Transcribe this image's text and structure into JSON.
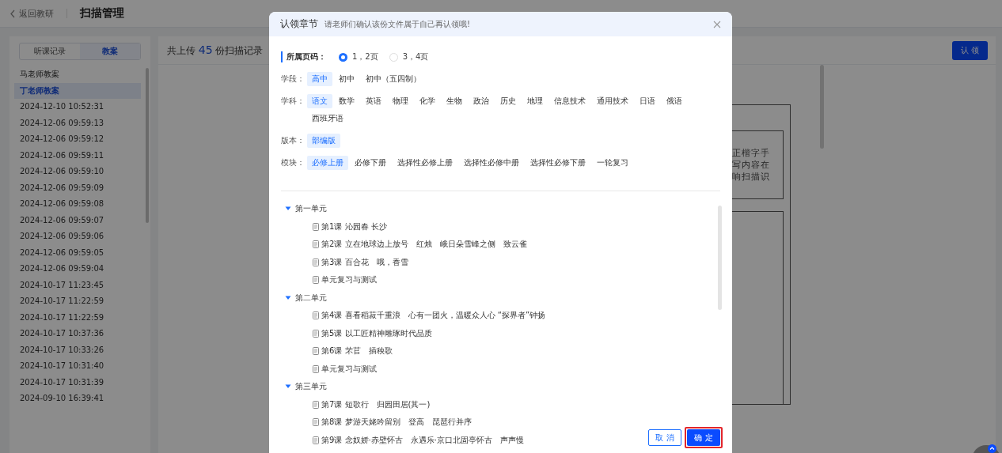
{
  "topbar": {
    "back_link": "返回教研",
    "title": "扫描管理"
  },
  "sidebar": {
    "tabs": [
      {
        "label": "听课记录",
        "selected": false
      },
      {
        "label": "教案",
        "selected": true
      }
    ],
    "items": [
      {
        "label": "马老师教案",
        "selected": false
      },
      {
        "label": "丁老师教案",
        "selected": true
      },
      {
        "label": "2024-12-10 10:52:31",
        "selected": false
      },
      {
        "label": "2024-12-06 09:59:13",
        "selected": false
      },
      {
        "label": "2024-12-06 09:59:12",
        "selected": false
      },
      {
        "label": "2024-12-06 09:59:11",
        "selected": false
      },
      {
        "label": "2024-12-06 09:59:10",
        "selected": false
      },
      {
        "label": "2024-12-06 09:59:09",
        "selected": false
      },
      {
        "label": "2024-12-06 09:59:08",
        "selected": false
      },
      {
        "label": "2024-12-06 09:59:07",
        "selected": false
      },
      {
        "label": "2024-12-06 09:59:06",
        "selected": false
      },
      {
        "label": "2024-12-06 09:59:05",
        "selected": false
      },
      {
        "label": "2024-12-06 09:59:04",
        "selected": false
      },
      {
        "label": "2024-10-17 11:23:45",
        "selected": false
      },
      {
        "label": "2024-10-17 11:22:59",
        "selected": false
      },
      {
        "label": "2024-10-17 11:22:59",
        "selected": false
      },
      {
        "label": "2024-10-17 10:37:36",
        "selected": false
      },
      {
        "label": "2024-10-17 10:33:26",
        "selected": false
      },
      {
        "label": "2024-10-17 10:31:40",
        "selected": false
      },
      {
        "label": "2024-10-17 10:31:39",
        "selected": false
      },
      {
        "label": "2024-09-10 16:39:41",
        "selected": false
      }
    ]
  },
  "main": {
    "summary": {
      "prefix": "共上传",
      "count": "45",
      "suffix": "份扫描记录"
    },
    "claim_button": "认 领",
    "document_lines": [
      "正楷字手",
      "写内容在",
      "响扫描识"
    ]
  },
  "dialog": {
    "title": "认领章节",
    "subtitle": "请老师们确认该份文件属于自己再认领哦!",
    "page_field": {
      "label": "所属页码：",
      "options": [
        {
          "label": "1，2页",
          "selected": true
        },
        {
          "label": "3，4页",
          "selected": false
        }
      ]
    },
    "filters": [
      {
        "label": "学段：",
        "options": [
          {
            "label": "高中",
            "selected": true
          },
          {
            "label": "初中",
            "selected": false
          },
          {
            "label": "初中（五四制）",
            "selected": false
          }
        ]
      },
      {
        "label": "学科：",
        "options": [
          {
            "label": "语文",
            "selected": true
          },
          {
            "label": "数学",
            "selected": false
          },
          {
            "label": "英语",
            "selected": false
          },
          {
            "label": "物理",
            "selected": false
          },
          {
            "label": "化学",
            "selected": false
          },
          {
            "label": "生物",
            "selected": false
          },
          {
            "label": "政治",
            "selected": false
          },
          {
            "label": "历史",
            "selected": false
          },
          {
            "label": "地理",
            "selected": false
          },
          {
            "label": "信息技术",
            "selected": false
          },
          {
            "label": "通用技术",
            "selected": false
          },
          {
            "label": "日语",
            "selected": false
          },
          {
            "label": "俄语",
            "selected": false
          },
          {
            "label": "西班牙语",
            "selected": false
          }
        ]
      },
      {
        "label": "版本：",
        "options": [
          {
            "label": "部编版",
            "selected": true
          }
        ]
      },
      {
        "label": "模块：",
        "options": [
          {
            "label": "必修上册",
            "selected": true
          },
          {
            "label": "必修下册",
            "selected": false
          },
          {
            "label": "选择性必修上册",
            "selected": false
          },
          {
            "label": "选择性必修中册",
            "selected": false
          },
          {
            "label": "选择性必修下册",
            "selected": false
          },
          {
            "label": "一轮复习",
            "selected": false
          }
        ]
      }
    ],
    "tree": [
      {
        "label": "第一单元",
        "expanded": true,
        "children": [
          {
            "label": "第1课 沁园春 长沙"
          },
          {
            "label": "第2课 立在地球边上放号　红烛　峨日朵雪峰之侧　致云雀"
          },
          {
            "label": "第3课 百合花　哦，香雪"
          },
          {
            "label": "单元复习与测试"
          }
        ]
      },
      {
        "label": "第二单元",
        "expanded": true,
        "children": [
          {
            "label": "第4课 喜看稻菽千重浪　心有一团火，温暖众人心 “探界者”钟扬"
          },
          {
            "label": "第5课 以工匠精神雕琢时代品质"
          },
          {
            "label": "第6课 芣苢　插秧歌"
          },
          {
            "label": "单元复习与测试"
          }
        ]
      },
      {
        "label": "第三单元",
        "expanded": true,
        "children": [
          {
            "label": "第7课 短歌行　归园田居(其一)"
          },
          {
            "label": "第8课 梦游天姥吟留别　登高　琵琶行并序"
          },
          {
            "label": "第9课 念奴娇·赤壁怀古　永遇乐·京口北固亭怀古　声声慢"
          }
        ]
      }
    ],
    "cancel_button": "取 消",
    "confirm_button": {
      "label": "确 定",
      "highlighted": true
    }
  }
}
